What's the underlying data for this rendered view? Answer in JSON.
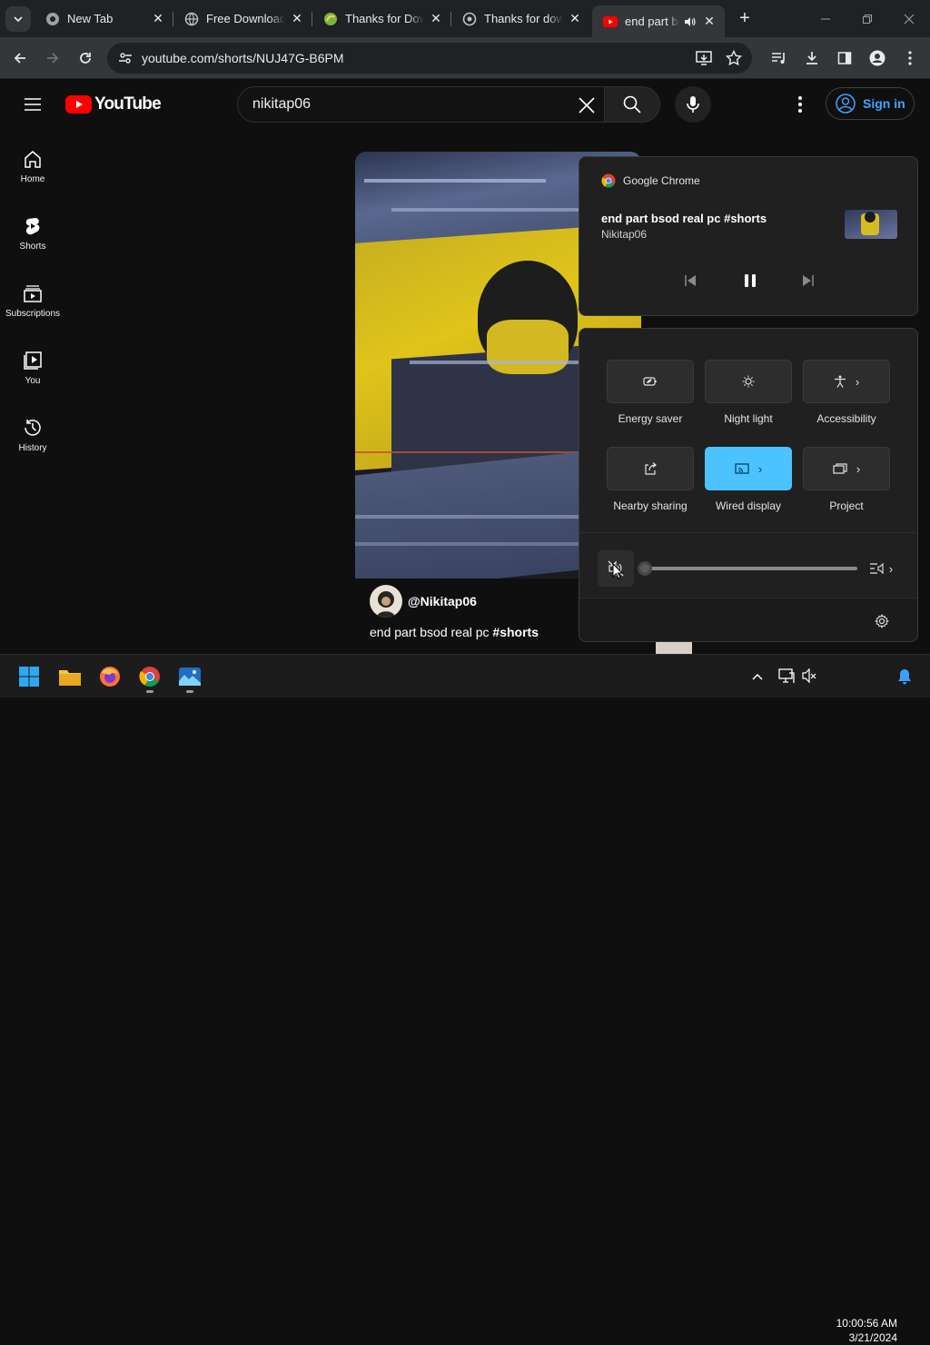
{
  "browser": {
    "tabs": [
      {
        "title": "New Tab",
        "icon": "chrome-icon"
      },
      {
        "title": "Free Download",
        "icon": "globe-icon"
      },
      {
        "title": "Thanks for Dow",
        "icon": "softonic-icon"
      },
      {
        "title": "Thanks for dow",
        "icon": "filehippo-icon"
      },
      {
        "title": "end part bs",
        "icon": "youtube-icon",
        "audio": true
      }
    ],
    "url": "youtube.com/shorts/NUJ47G-B6PM"
  },
  "youtube": {
    "logo_text": "YouTube",
    "search_value": "nikitap06",
    "sign_in": "Sign in",
    "guide": [
      {
        "label": "Home",
        "icon": "home-icon"
      },
      {
        "label": "Shorts",
        "icon": "shorts-icon"
      },
      {
        "label": "Subscriptions",
        "icon": "subscriptions-icon"
      },
      {
        "label": "You",
        "icon": "you-icon"
      },
      {
        "label": "History",
        "icon": "history-icon"
      }
    ],
    "short": {
      "channel": "@Nikitap06",
      "title_text": "end part bsod real pc ",
      "title_tag": "#shorts"
    }
  },
  "media_flyout": {
    "app": "Google Chrome",
    "title": "end part bsod real pc #shorts",
    "artist": "Nikitap06"
  },
  "quick_settings": {
    "tiles": [
      {
        "label": "Energy saver",
        "icon": "energy-saver-icon",
        "on": false,
        "chevron": false
      },
      {
        "label": "Night light",
        "icon": "night-light-icon",
        "on": false,
        "chevron": false
      },
      {
        "label": "Accessibility",
        "icon": "accessibility-icon",
        "on": false,
        "chevron": true
      },
      {
        "label": "Nearby sharing",
        "icon": "nearby-sharing-icon",
        "on": false,
        "chevron": false
      },
      {
        "label": "Wired display",
        "icon": "cast-icon",
        "on": true,
        "chevron": true
      },
      {
        "label": "Project",
        "icon": "project-icon",
        "on": false,
        "chevron": true
      }
    ],
    "volume": {
      "muted": true,
      "level": 0
    }
  },
  "taskbar": {
    "time": "10:00:56 AM",
    "date": "3/21/2024"
  },
  "colors": {
    "youtube_red": "#ff0000",
    "accent": "#4cc2ff",
    "link": "#3ea6ff"
  }
}
